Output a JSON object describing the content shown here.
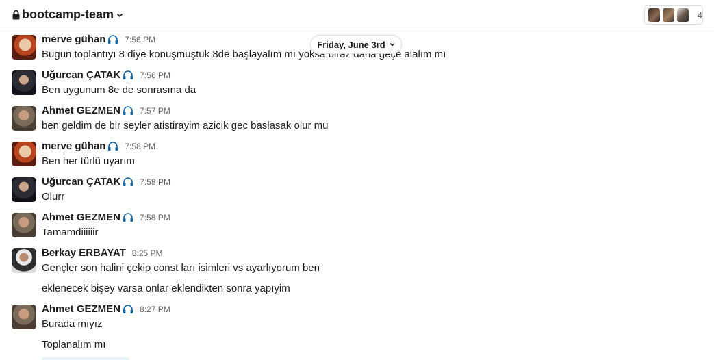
{
  "channel": {
    "name": "bootcamp-team",
    "member_count": "4"
  },
  "date_divider": {
    "label": "Friday, June 3rd"
  },
  "colors": {
    "text": "#1d1c1d",
    "muted": "#616061",
    "headphone": "#1264a3"
  },
  "messages": [
    {
      "author": "merve gühan",
      "time": "7:56 PM",
      "headphones": true,
      "lines": [
        "Bugün toplantıyı 8 diye konuşmuştuk 8de başlayalım mı yoksa biraz daha geçe alalım mı"
      ]
    },
    {
      "author": "Uğurcan ÇATAK",
      "time": "7:56 PM",
      "headphones": true,
      "lines": [
        "Ben uygunum 8e de sonrasına da"
      ]
    },
    {
      "author": "Ahmet GEZMEN",
      "time": "7:57 PM",
      "headphones": true,
      "lines": [
        "ben geldim de bir seyler atistirayim azicik gec baslasak olur mu"
      ]
    },
    {
      "author": "merve gühan",
      "time": "7:58 PM",
      "headphones": true,
      "lines": [
        "Ben her türlü uyarım"
      ]
    },
    {
      "author": "Uğurcan ÇATAK",
      "time": "7:58 PM",
      "headphones": true,
      "lines": [
        "Olurr"
      ]
    },
    {
      "author": "Ahmet GEZMEN",
      "time": "7:58 PM",
      "headphones": true,
      "lines": [
        "Tamamdiiiiiir"
      ]
    },
    {
      "author": "Berkay ERBAYAT",
      "time": "8:25 PM",
      "headphones": false,
      "lines": [
        "Gençler son halini çekip const ları isimleri vs ayarlıyorum ben",
        "eklenecek bişey varsa onlar eklendikten sonra yapıyim"
      ]
    },
    {
      "author": "Ahmet GEZMEN",
      "time": "8:27 PM",
      "headphones": true,
      "lines": [
        "Burada mıyız",
        "Toplanalım mı"
      ]
    }
  ]
}
